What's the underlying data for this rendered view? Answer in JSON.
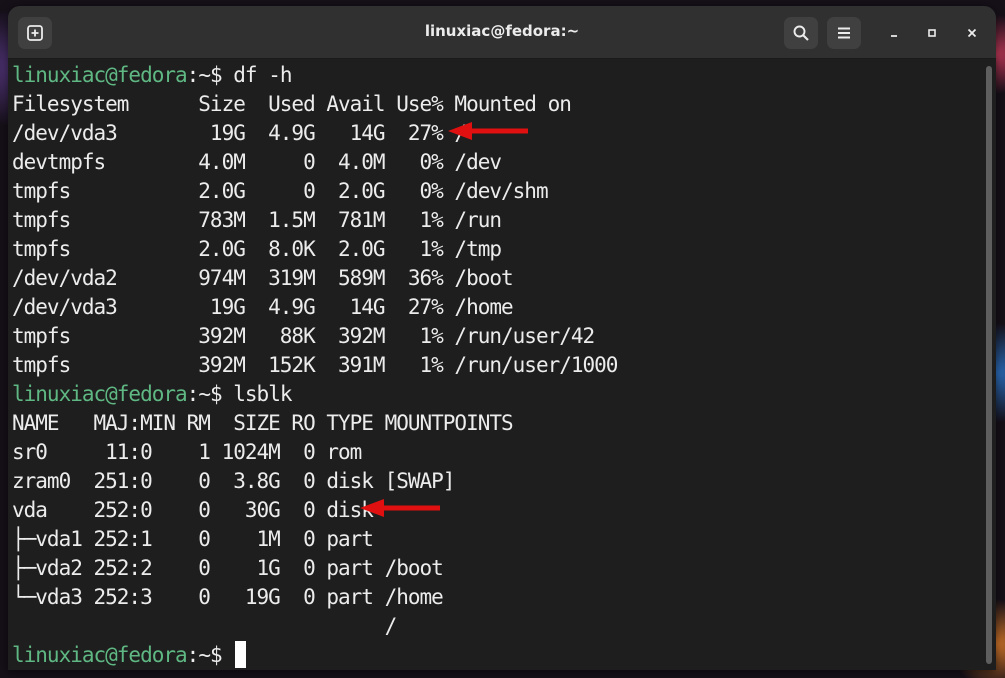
{
  "window": {
    "title": "linuxiac@fedora:~"
  },
  "icons": {
    "new_tab": "new-tab-icon",
    "search": "search-icon",
    "menu": "hamburger-menu-icon",
    "minimize": "minimize-icon",
    "maximize": "maximize-icon",
    "close": "close-icon"
  },
  "colors": {
    "prompt_user": "#5fb883",
    "arrow": "#e01010",
    "terminal_bg": "#1e1e1e",
    "text": "#ececec"
  },
  "prompt": {
    "user_host": "linuxiac@fedora",
    "sep": ":",
    "path": "~",
    "symbol": "$ "
  },
  "commands": {
    "df": "df -h",
    "lsblk": "lsblk",
    "last": ""
  },
  "df_output": [
    "Filesystem      Size  Used Avail Use% Mounted on",
    "/dev/vda3        19G  4.9G   14G  27% /",
    "devtmpfs        4.0M     0  4.0M   0% /dev",
    "tmpfs           2.0G     0  2.0G   0% /dev/shm",
    "tmpfs           783M  1.5M  781M   1% /run",
    "tmpfs           2.0G  8.0K  2.0G   1% /tmp",
    "/dev/vda2       974M  319M  589M  36% /boot",
    "/dev/vda3        19G  4.9G   14G  27% /home",
    "tmpfs           392M   88K  392M   1% /run/user/42",
    "tmpfs           392M  152K  391M   1% /run/user/1000"
  ],
  "lsblk_output": [
    "NAME   MAJ:MIN RM  SIZE RO TYPE MOUNTPOINTS",
    "sr0     11:0    1 1024M  0 rom",
    "zram0  251:0    0  3.8G  0 disk [SWAP]",
    "vda    252:0    0   30G  0 disk",
    "├─vda1 252:1    0    1M  0 part",
    "├─vda2 252:2    0    1G  0 part /boot",
    "└─vda3 252:3    0   19G  0 part /home",
    "                                /"
  ]
}
